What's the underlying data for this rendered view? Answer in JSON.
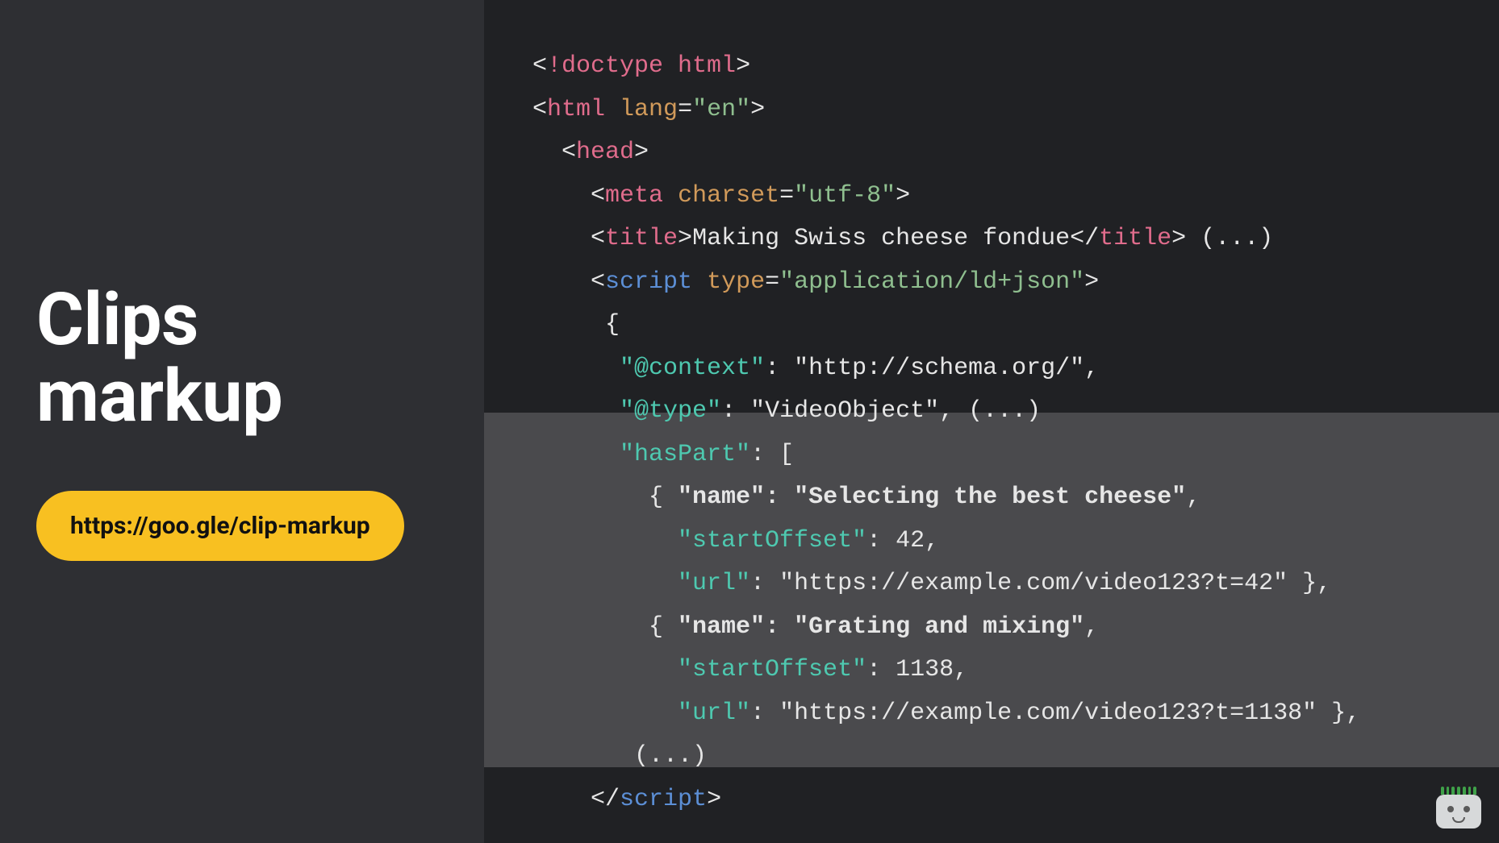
{
  "title_line1": "Clips",
  "title_line2": "markup",
  "link_url": "https://goo.gle/clip-markup",
  "code": {
    "l1_tag": "!doctype html",
    "l2_tag": "html",
    "l2_attr": "lang",
    "l2_val": "\"en\"",
    "l3_tag": "head",
    "l4_tag": "meta",
    "l4_attr": "charset",
    "l4_val": "\"utf-8\"",
    "l5_tag": "title",
    "l5_text": "Making Swiss cheese fondue",
    "l5_close": "title",
    "l5_ellipsis": "(...)",
    "l6_tag": "script",
    "l6_attr": "type",
    "l6_val": "\"application/ld+json\"",
    "l7": "{",
    "l8_key": "\"@context\"",
    "l8_val": "\"http://schema.org/\"",
    "l9_key": "\"@type\"",
    "l9_val": "\"VideoObject\"",
    "l9_ellipsis": "(...)",
    "l10_key": "\"hasPart\"",
    "l11_name_key": "\"name\"",
    "l11_name_val": "\"Selecting the best cheese\"",
    "l12_key": "\"startOffset\"",
    "l12_val": "42",
    "l13_key": "\"url\"",
    "l13_val": "\"https://example.com/video123?t=42\"",
    "l14_name_key": "\"name\"",
    "l14_name_val": "\"Grating and mixing\"",
    "l15_key": "\"startOffset\"",
    "l15_val": "1138",
    "l16_key": "\"url\"",
    "l16_val": "\"https://example.com/video123?t=1138\"",
    "l17": "(...)",
    "l18_close": "script"
  }
}
